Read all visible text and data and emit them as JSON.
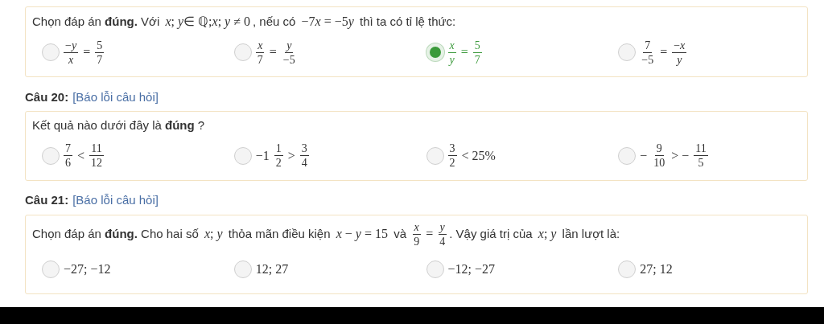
{
  "questions": [
    {
      "prompt": [
        {
          "kind": "text",
          "s": "Chọn đáp án "
        },
        {
          "kind": "bold",
          "s": "đúng."
        },
        {
          "kind": "text",
          "s": " Với "
        },
        {
          "kind": "math",
          "s": "x; y∈ ℚ;x; y ≠ 0"
        },
        {
          "kind": "text",
          "s": ", nếu có "
        },
        {
          "kind": "math",
          "s": "−7x = −5y"
        },
        {
          "kind": "text",
          "s": " thì ta có tỉ lệ thức:"
        }
      ],
      "options": [
        {
          "selected": false,
          "parts": [
            {
              "kind": "frac",
              "num": "−y",
              "den": "x"
            },
            {
              "kind": "math",
              "s": "="
            },
            {
              "kind": "frac",
              "num": "5",
              "den": "7"
            }
          ]
        },
        {
          "selected": false,
          "parts": [
            {
              "kind": "frac",
              "num": "x",
              "den": "7"
            },
            {
              "kind": "math",
              "s": "="
            },
            {
              "kind": "frac",
              "num": "y",
              "den": "−5"
            }
          ]
        },
        {
          "selected": true,
          "parts": [
            {
              "kind": "frac",
              "num": "x",
              "den": "y"
            },
            {
              "kind": "math",
              "s": "="
            },
            {
              "kind": "frac",
              "num": "5",
              "den": "7"
            }
          ]
        },
        {
          "selected": false,
          "parts": [
            {
              "kind": "frac",
              "num": "7",
              "den": "−5"
            },
            {
              "kind": "math",
              "s": "="
            },
            {
              "kind": "frac",
              "num": "−x",
              "den": "y"
            }
          ]
        }
      ]
    },
    {
      "label": "Câu 20:",
      "report_link": "[Báo lỗi câu hỏi]",
      "prompt": [
        {
          "kind": "text",
          "s": "Kết quả nào dưới đây là "
        },
        {
          "kind": "bold",
          "s": "đúng"
        },
        {
          "kind": "text",
          "s": " ?"
        }
      ],
      "options": [
        {
          "selected": false,
          "parts": [
            {
              "kind": "frac",
              "num": "7",
              "den": "6"
            },
            {
              "kind": "math",
              "s": "<"
            },
            {
              "kind": "frac",
              "num": "11",
              "den": "12"
            }
          ]
        },
        {
          "selected": false,
          "parts": [
            {
              "kind": "math",
              "s": "−1"
            },
            {
              "kind": "frac",
              "num": "1",
              "den": "2"
            },
            {
              "kind": "math",
              "s": ">"
            },
            {
              "kind": "frac",
              "num": "3",
              "den": "4"
            }
          ]
        },
        {
          "selected": false,
          "parts": [
            {
              "kind": "frac",
              "num": "3",
              "den": "2"
            },
            {
              "kind": "math",
              "s": "< 25%"
            }
          ]
        },
        {
          "selected": false,
          "parts": [
            {
              "kind": "math",
              "s": "−"
            },
            {
              "kind": "frac",
              "num": "9",
              "den": "10"
            },
            {
              "kind": "math",
              "s": "> −"
            },
            {
              "kind": "frac",
              "num": "11",
              "den": "5"
            }
          ]
        }
      ]
    },
    {
      "label": "Câu 21:",
      "report_link": "[Báo lỗi câu hỏi]",
      "prompt": [
        {
          "kind": "text",
          "s": "Chọn đáp án "
        },
        {
          "kind": "bold",
          "s": "đúng."
        },
        {
          "kind": "text",
          "s": " Cho hai số "
        },
        {
          "kind": "math",
          "s": "x; y"
        },
        {
          "kind": "text",
          "s": " thỏa mãn điều kiện "
        },
        {
          "kind": "math",
          "s": "x − y = 15"
        },
        {
          "kind": "text",
          "s": " và "
        },
        {
          "kind": "frac",
          "num": "x",
          "den": "9"
        },
        {
          "kind": "math",
          "s": "="
        },
        {
          "kind": "frac",
          "num": "y",
          "den": "4"
        },
        {
          "kind": "text",
          "s": ". Vậy giá trị của "
        },
        {
          "kind": "math",
          "s": "x; y"
        },
        {
          "kind": "text",
          "s": " lần lượt là:"
        }
      ],
      "options": [
        {
          "selected": false,
          "parts": [
            {
              "kind": "math",
              "s": "−27; −12"
            }
          ]
        },
        {
          "selected": false,
          "parts": [
            {
              "kind": "math",
              "s": "12; 27"
            }
          ]
        },
        {
          "selected": false,
          "parts": [
            {
              "kind": "math",
              "s": "−12; −27"
            }
          ]
        },
        {
          "selected": false,
          "parts": [
            {
              "kind": "math",
              "s": "27; 12"
            }
          ]
        }
      ]
    }
  ]
}
